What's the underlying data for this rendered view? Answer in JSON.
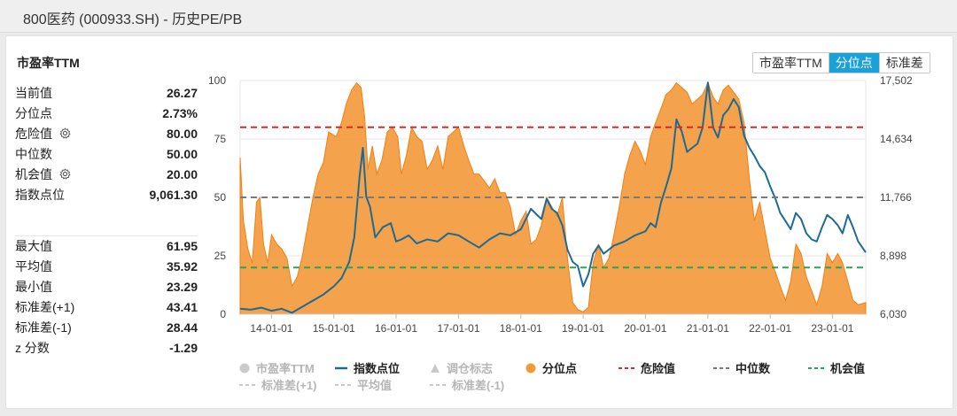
{
  "page_title": "800医药 (000933.SH) - 历史PE/PB",
  "panel_title": "市盈率TTM",
  "tabs": [
    {
      "label": "市盈率TTM",
      "active": false
    },
    {
      "label": "分位点",
      "active": true
    },
    {
      "label": "标准差",
      "active": false
    }
  ],
  "stats_top": [
    {
      "label": "当前值",
      "value": "26.27",
      "gear": false
    },
    {
      "label": "分位点",
      "value": "2.73%",
      "gear": false
    },
    {
      "label": "危险值",
      "value": "80.00",
      "gear": true
    },
    {
      "label": "中位数",
      "value": "50.00",
      "gear": false
    },
    {
      "label": "机会值",
      "value": "20.00",
      "gear": true
    },
    {
      "label": "指数点位",
      "value": "9,061.30",
      "gear": false
    }
  ],
  "stats_bottom": [
    {
      "label": "最大值",
      "value": "61.95"
    },
    {
      "label": "平均值",
      "value": "35.92"
    },
    {
      "label": "最小值",
      "value": "23.29"
    },
    {
      "label": "标准差(+1)",
      "value": "43.41"
    },
    {
      "label": "标准差(-1)",
      "value": "28.44"
    },
    {
      "label": "z 分数",
      "value": "-1.29"
    }
  ],
  "colors": {
    "percentile_fill": "#f39a3c",
    "index_line": "#1d6b94",
    "danger": "#d62a2a",
    "median": "#7a7a7a",
    "opportunity": "#27a556",
    "tab_active": "#1aa2d8"
  },
  "legend": [
    {
      "label": "市盈率TTM",
      "marker": "dot",
      "color": "#c9c9c9",
      "enabled": false
    },
    {
      "label": "指数点位",
      "marker": "line",
      "color": "#1d6b94",
      "enabled": true
    },
    {
      "label": "调仓标志",
      "marker": "triangle",
      "color": "#c9c9c9",
      "enabled": false
    },
    {
      "label": "分位点",
      "marker": "dot",
      "color": "#f39a3c",
      "enabled": true
    },
    {
      "label": "危险值",
      "marker": "dash",
      "color": "#d62a2a",
      "enabled": true
    },
    {
      "label": "中位数",
      "marker": "dash",
      "color": "#7a7a7a",
      "enabled": true
    },
    {
      "label": "机会值",
      "marker": "dash",
      "color": "#27a556",
      "enabled": true
    },
    {
      "label": "标准差(+1)",
      "marker": "dash",
      "color": "#c9c9c9",
      "enabled": false
    },
    {
      "label": "平均值",
      "marker": "dash",
      "color": "#c9c9c9",
      "enabled": false
    },
    {
      "label": "标准差(-1)",
      "marker": "dash",
      "color": "#c9c9c9",
      "enabled": false
    }
  ],
  "chart_data": {
    "type": "area",
    "x_ticks": [
      "14-01-01",
      "15-01-01",
      "16-01-01",
      "17-01-01",
      "18-01-01",
      "19-01-01",
      "20-01-01",
      "21-01-01",
      "22-01-01",
      "23-01-01"
    ],
    "x_range": [
      "2013-07-01",
      "2023-07-15"
    ],
    "y_left": {
      "range": [
        0,
        100
      ],
      "ticks": [
        "0",
        "25",
        "50",
        "75",
        "100"
      ]
    },
    "y_right": {
      "range": [
        6030,
        17502
      ],
      "ticks": [
        "6,030",
        "8,898",
        "11,766",
        "14,634",
        "17,502"
      ]
    },
    "grid": true,
    "reference_lines": [
      {
        "name": "危险值",
        "value": 80
      },
      {
        "name": "中位数",
        "value": 50
      },
      {
        "name": "机会值",
        "value": 20
      }
    ],
    "series": [
      {
        "name": "分位点",
        "axis": "left",
        "kind": "area",
        "points": [
          [
            "2013-07-01",
            67
          ],
          [
            "2013-07-20",
            40
          ],
          [
            "2013-08-15",
            28
          ],
          [
            "2013-09-10",
            22
          ],
          [
            "2013-10-05",
            48
          ],
          [
            "2013-10-25",
            50
          ],
          [
            "2013-11-15",
            30
          ],
          [
            "2013-12-10",
            22
          ],
          [
            "2014-01-01",
            34
          ],
          [
            "2014-02-01",
            30
          ],
          [
            "2014-03-01",
            28
          ],
          [
            "2014-04-01",
            24
          ],
          [
            "2014-05-01",
            12
          ],
          [
            "2014-06-01",
            16
          ],
          [
            "2014-07-01",
            25
          ],
          [
            "2014-08-01",
            38
          ],
          [
            "2014-09-01",
            50
          ],
          [
            "2014-10-01",
            60
          ],
          [
            "2014-11-01",
            65
          ],
          [
            "2014-12-01",
            78
          ],
          [
            "2015-01-15",
            76
          ],
          [
            "2015-02-15",
            82
          ],
          [
            "2015-03-15",
            90
          ],
          [
            "2015-04-15",
            96
          ],
          [
            "2015-05-15",
            99
          ],
          [
            "2015-06-10",
            97
          ],
          [
            "2015-07-01",
            84
          ],
          [
            "2015-07-20",
            62
          ],
          [
            "2015-08-15",
            72
          ],
          [
            "2015-09-10",
            60
          ],
          [
            "2015-10-10",
            66
          ],
          [
            "2015-11-10",
            78
          ],
          [
            "2015-12-10",
            80
          ],
          [
            "2016-01-10",
            76
          ],
          [
            "2016-02-01",
            60
          ],
          [
            "2016-03-01",
            68
          ],
          [
            "2016-04-01",
            80
          ],
          [
            "2016-05-01",
            76
          ],
          [
            "2016-06-01",
            74
          ],
          [
            "2016-07-01",
            62
          ],
          [
            "2016-08-01",
            66
          ],
          [
            "2016-09-01",
            72
          ],
          [
            "2016-10-01",
            62
          ],
          [
            "2016-11-01",
            76
          ],
          [
            "2016-12-01",
            78
          ],
          [
            "2017-01-01",
            80
          ],
          [
            "2017-02-01",
            72
          ],
          [
            "2017-03-01",
            66
          ],
          [
            "2017-04-01",
            60
          ],
          [
            "2017-05-01",
            60
          ],
          [
            "2017-06-01",
            57
          ],
          [
            "2017-07-01",
            54
          ],
          [
            "2017-08-01",
            58
          ],
          [
            "2017-09-01",
            52
          ],
          [
            "2017-10-01",
            52
          ],
          [
            "2017-11-01",
            46
          ],
          [
            "2017-12-01",
            34
          ],
          [
            "2018-01-01",
            40
          ],
          [
            "2018-02-01",
            44
          ],
          [
            "2018-03-01",
            30
          ],
          [
            "2018-04-01",
            32
          ],
          [
            "2018-05-01",
            38
          ],
          [
            "2018-06-01",
            50
          ],
          [
            "2018-07-01",
            46
          ],
          [
            "2018-08-01",
            42
          ],
          [
            "2018-09-01",
            50
          ],
          [
            "2018-10-01",
            24
          ],
          [
            "2018-11-01",
            5
          ],
          [
            "2018-12-01",
            2
          ],
          [
            "2019-01-01",
            1
          ],
          [
            "2019-02-01",
            3
          ],
          [
            "2019-03-01",
            22
          ],
          [
            "2019-04-01",
            30
          ],
          [
            "2019-05-01",
            20
          ],
          [
            "2019-06-01",
            24
          ],
          [
            "2019-07-01",
            34
          ],
          [
            "2019-08-01",
            46
          ],
          [
            "2019-09-01",
            60
          ],
          [
            "2019-10-01",
            68
          ],
          [
            "2019-11-01",
            74
          ],
          [
            "2019-12-01",
            70
          ],
          [
            "2020-01-01",
            64
          ],
          [
            "2020-02-01",
            76
          ],
          [
            "2020-03-01",
            82
          ],
          [
            "2020-04-01",
            88
          ],
          [
            "2020-05-01",
            94
          ],
          [
            "2020-06-01",
            96
          ],
          [
            "2020-07-01",
            99
          ],
          [
            "2020-08-01",
            97
          ],
          [
            "2020-09-01",
            95
          ],
          [
            "2020-10-01",
            90
          ],
          [
            "2020-11-01",
            92
          ],
          [
            "2020-12-01",
            94
          ],
          [
            "2021-01-01",
            99
          ],
          [
            "2021-02-01",
            93
          ],
          [
            "2021-03-01",
            90
          ],
          [
            "2021-04-01",
            96
          ],
          [
            "2021-05-01",
            98
          ],
          [
            "2021-06-01",
            95
          ],
          [
            "2021-07-01",
            92
          ],
          [
            "2021-08-01",
            82
          ],
          [
            "2021-09-01",
            58
          ],
          [
            "2021-10-01",
            40
          ],
          [
            "2021-11-01",
            48
          ],
          [
            "2021-12-01",
            36
          ],
          [
            "2022-01-01",
            24
          ],
          [
            "2022-02-01",
            18
          ],
          [
            "2022-03-01",
            12
          ],
          [
            "2022-04-01",
            6
          ],
          [
            "2022-05-01",
            14
          ],
          [
            "2022-06-01",
            30
          ],
          [
            "2022-07-01",
            26
          ],
          [
            "2022-08-01",
            16
          ],
          [
            "2022-09-01",
            10
          ],
          [
            "2022-10-01",
            4
          ],
          [
            "2022-11-01",
            12
          ],
          [
            "2022-12-01",
            26
          ],
          [
            "2023-01-01",
            22
          ],
          [
            "2023-02-01",
            26
          ],
          [
            "2023-03-01",
            22
          ],
          [
            "2023-04-01",
            14
          ],
          [
            "2023-05-01",
            6
          ],
          [
            "2023-06-01",
            4
          ],
          [
            "2023-07-15",
            5
          ]
        ]
      },
      {
        "name": "指数点位",
        "axis": "right",
        "kind": "line",
        "points": [
          [
            "2013-07-01",
            6300
          ],
          [
            "2013-09-01",
            6250
          ],
          [
            "2013-11-01",
            6350
          ],
          [
            "2014-01-01",
            6200
          ],
          [
            "2014-03-01",
            6300
          ],
          [
            "2014-05-01",
            6100
          ],
          [
            "2014-07-01",
            6400
          ],
          [
            "2014-09-01",
            6700
          ],
          [
            "2014-11-01",
            7000
          ],
          [
            "2015-01-01",
            7400
          ],
          [
            "2015-02-15",
            7800
          ],
          [
            "2015-04-01",
            8600
          ],
          [
            "2015-05-01",
            9800
          ],
          [
            "2015-06-01",
            12800
          ],
          [
            "2015-06-20",
            14200
          ],
          [
            "2015-07-10",
            11800
          ],
          [
            "2015-08-01",
            11300
          ],
          [
            "2015-09-01",
            9800
          ],
          [
            "2015-10-15",
            10300
          ],
          [
            "2015-12-01",
            10500
          ],
          [
            "2016-01-01",
            9600
          ],
          [
            "2016-02-01",
            9700
          ],
          [
            "2016-03-15",
            9900
          ],
          [
            "2016-05-01",
            9500
          ],
          [
            "2016-07-01",
            9700
          ],
          [
            "2016-09-01",
            9600
          ],
          [
            "2016-11-01",
            10000
          ],
          [
            "2017-01-01",
            9900
          ],
          [
            "2017-03-01",
            9600
          ],
          [
            "2017-05-01",
            9300
          ],
          [
            "2017-07-01",
            9700
          ],
          [
            "2017-09-01",
            10000
          ],
          [
            "2017-11-01",
            9900
          ],
          [
            "2018-01-01",
            10200
          ],
          [
            "2018-03-01",
            11200
          ],
          [
            "2018-05-01",
            10700
          ],
          [
            "2018-06-01",
            11700
          ],
          [
            "2018-07-01",
            11200
          ],
          [
            "2018-08-01",
            11000
          ],
          [
            "2018-09-01",
            10400
          ],
          [
            "2018-10-01",
            9200
          ],
          [
            "2018-11-01",
            8600
          ],
          [
            "2018-12-01",
            8400
          ],
          [
            "2019-01-01",
            7400
          ],
          [
            "2019-02-01",
            8000
          ],
          [
            "2019-03-01",
            9000
          ],
          [
            "2019-04-01",
            9400
          ],
          [
            "2019-05-01",
            9000
          ],
          [
            "2019-07-01",
            9400
          ],
          [
            "2019-09-01",
            9600
          ],
          [
            "2019-11-01",
            9900
          ],
          [
            "2020-01-01",
            10100
          ],
          [
            "2020-02-01",
            10500
          ],
          [
            "2020-03-01",
            10300
          ],
          [
            "2020-04-01",
            11500
          ],
          [
            "2020-05-01",
            12300
          ],
          [
            "2020-06-01",
            13200
          ],
          [
            "2020-07-01",
            15600
          ],
          [
            "2020-08-01",
            15000
          ],
          [
            "2020-09-01",
            14000
          ],
          [
            "2020-10-01",
            14200
          ],
          [
            "2020-11-01",
            14400
          ],
          [
            "2020-12-01",
            15200
          ],
          [
            "2021-01-01",
            17400
          ],
          [
            "2021-02-01",
            15200
          ],
          [
            "2021-03-01",
            14700
          ],
          [
            "2021-04-01",
            15800
          ],
          [
            "2021-05-01",
            16100
          ],
          [
            "2021-06-01",
            16600
          ],
          [
            "2021-07-01",
            16200
          ],
          [
            "2021-08-01",
            14800
          ],
          [
            "2021-09-01",
            14200
          ],
          [
            "2021-10-01",
            13800
          ],
          [
            "2021-11-01",
            13300
          ],
          [
            "2021-12-01",
            13000
          ],
          [
            "2022-01-01",
            12300
          ],
          [
            "2022-02-01",
            11700
          ],
          [
            "2022-03-01",
            11000
          ],
          [
            "2022-04-01",
            10600
          ],
          [
            "2022-05-01",
            10200
          ],
          [
            "2022-06-01",
            11000
          ],
          [
            "2022-07-01",
            10700
          ],
          [
            "2022-08-01",
            10000
          ],
          [
            "2022-09-01",
            9700
          ],
          [
            "2022-10-01",
            9600
          ],
          [
            "2022-11-01",
            10300
          ],
          [
            "2022-12-01",
            10900
          ],
          [
            "2023-01-01",
            10700
          ],
          [
            "2023-02-01",
            10400
          ],
          [
            "2023-03-01",
            10000
          ],
          [
            "2023-04-01",
            10900
          ],
          [
            "2023-05-01",
            10300
          ],
          [
            "2023-06-01",
            9600
          ],
          [
            "2023-07-15",
            9061
          ]
        ]
      }
    ]
  }
}
